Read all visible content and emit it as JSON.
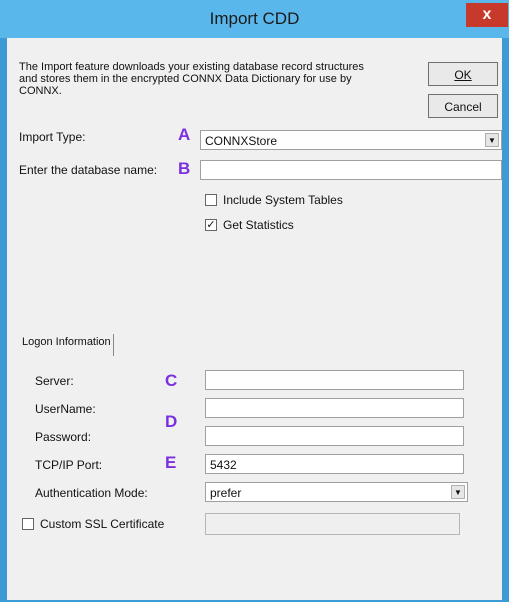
{
  "window": {
    "title": "Import CDD",
    "close_label": "x"
  },
  "description": "The Import feature downloads your existing database record structures and stores them in the encrypted CONNX Data Dictionary for use by CONNX.",
  "buttons": {
    "ok_label": "OK",
    "cancel_label": "Cancel"
  },
  "import_type": {
    "label": "Import Type:",
    "marker": "A",
    "value": "CONNXStore"
  },
  "database_name": {
    "label": "Enter the database name:",
    "marker": "B",
    "value": ""
  },
  "options": {
    "include_system_tables": {
      "label": "Include System Tables",
      "checked": false
    },
    "get_statistics": {
      "label": "Get Statistics",
      "checked": true,
      "check_glyph": "✓"
    }
  },
  "logon_tab": {
    "label": "Logon Information"
  },
  "logon": {
    "server": {
      "label": "Server:",
      "marker": "C",
      "value": ""
    },
    "username": {
      "label": "UserName:",
      "marker": "D",
      "value": ""
    },
    "password": {
      "label": "Password:",
      "value": ""
    },
    "tcp_port": {
      "label": "TCP/IP Port:",
      "marker": "E",
      "value": "5432"
    },
    "auth_mode": {
      "label": "Authentication Mode:",
      "value": "prefer"
    },
    "custom_ssl": {
      "label": "Custom SSL Certificate",
      "checked": false,
      "value": ""
    }
  },
  "colors": {
    "title_bar": "#59b7ec",
    "frame": "#3c9ad4",
    "close": "#c7392b",
    "marker": "#7b2fe0"
  }
}
